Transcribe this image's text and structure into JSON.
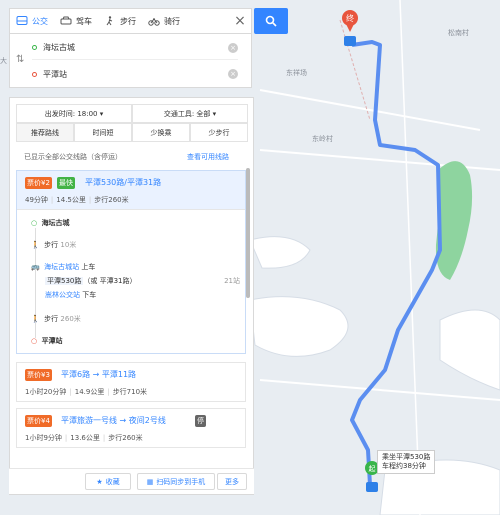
{
  "map": {
    "labels": [
      "松南村",
      "东祥场",
      "东岭村",
      "大"
    ],
    "route_color": "#5b8ef0",
    "park_color": "#8ed49f",
    "water_color": "#ffffff",
    "callout": {
      "line1": "乘坐平潭530路",
      "line2": "车程约38分钟"
    },
    "start_marker": "终",
    "end_marker": "起"
  },
  "tabs": [
    {
      "label": "公交",
      "icon": "bus-icon",
      "active": true
    },
    {
      "label": "驾车",
      "icon": "car-icon",
      "active": false
    },
    {
      "label": "步行",
      "icon": "walk-icon",
      "active": false
    },
    {
      "label": "骑行",
      "icon": "bike-icon",
      "active": false
    }
  ],
  "close_glyph": "×",
  "search": {
    "icon": "search-icon"
  },
  "inputs": {
    "from": "海坛古城",
    "to": "平潭站",
    "swap_glyph": "⇅",
    "clear_glyph": "×"
  },
  "filters": {
    "depart_label": "出发时间: 18:00",
    "tool_label": "交通工具: 全部",
    "sort_options": [
      "推荐路线",
      "时间短",
      "少换乘",
      "少步行"
    ]
  },
  "summary": "已显示全部公交线路（含停运）",
  "view_link": "查看可用线路",
  "routes": [
    {
      "price": "票价¥2",
      "tag": "最快",
      "title": "平潭530路/平潭31路",
      "time": "49分钟",
      "distance": "14.5公里",
      "walk": "步行260米",
      "steps": {
        "start": "海坛古城",
        "walk1": "步行",
        "walk1_dist": "10米",
        "board_stop": "海坛古城站",
        "board_suffix": "上车",
        "line": "平潭530路",
        "line_alt": "（或 平潭31路）",
        "stops": "21站",
        "alight_stop": "嵩林公交站",
        "alight_suffix": "下车",
        "walk2": "步行",
        "walk2_dist": "260米",
        "end": "平潭站"
      }
    },
    {
      "price": "票价¥3",
      "title": "平潭6路 → 平潭11路",
      "time": "1小时20分钟",
      "distance": "14.9公里",
      "walk": "步行710米"
    },
    {
      "price": "票价¥4",
      "title": "平潭旅游一号线 → 夜间2号线",
      "extra": "停",
      "time": "1小时9分钟",
      "distance": "13.6公里",
      "walk": "步行260米"
    }
  ],
  "bottom": {
    "fav": "收藏",
    "phone": "扫码同步到手机",
    "more": "更多"
  }
}
